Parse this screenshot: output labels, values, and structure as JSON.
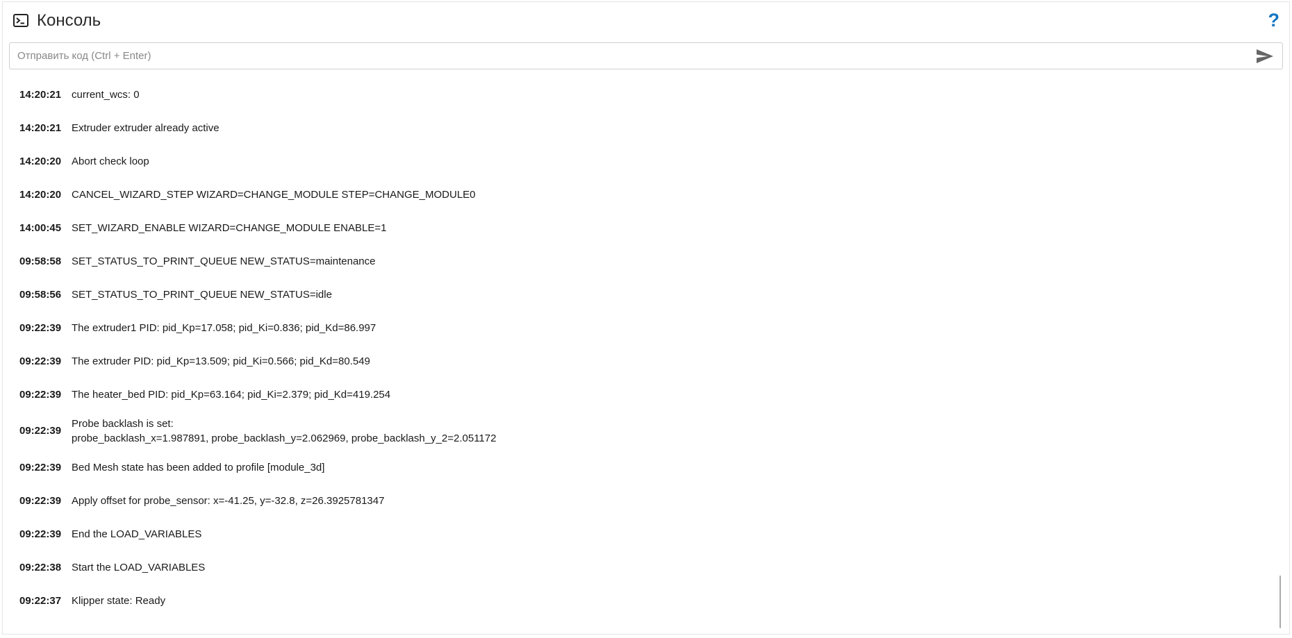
{
  "header": {
    "title": "Консоль",
    "help_label": "?"
  },
  "command_input": {
    "placeholder": "Отправить код (Ctrl + Enter)",
    "value": ""
  },
  "log": [
    {
      "time": "14:20:21",
      "message": "current_wcs: 0"
    },
    {
      "time": "14:20:21",
      "message": "Extruder extruder already active"
    },
    {
      "time": "14:20:20",
      "message": "Abort check loop"
    },
    {
      "time": "14:20:20",
      "message": "CANCEL_WIZARD_STEP WIZARD=CHANGE_MODULE STEP=CHANGE_MODULE0"
    },
    {
      "time": "14:00:45",
      "message": "SET_WIZARD_ENABLE WIZARD=CHANGE_MODULE ENABLE=1"
    },
    {
      "time": "09:58:58",
      "message": "SET_STATUS_TO_PRINT_QUEUE NEW_STATUS=maintenance"
    },
    {
      "time": "09:58:56",
      "message": "SET_STATUS_TO_PRINT_QUEUE NEW_STATUS=idle"
    },
    {
      "time": "09:22:39",
      "message": "The extruder1 PID: pid_Kp=17.058; pid_Ki=0.836; pid_Kd=86.997"
    },
    {
      "time": "09:22:39",
      "message": "The extruder PID: pid_Kp=13.509; pid_Ki=0.566; pid_Kd=80.549"
    },
    {
      "time": "09:22:39",
      "message": "The heater_bed PID: pid_Kp=63.164; pid_Ki=2.379; pid_Kd=419.254"
    },
    {
      "time": "09:22:39",
      "message": "Probe backlash is set:\nprobe_backlash_x=1.987891, probe_backlash_y=2.062969, probe_backlash_y_2=2.051172"
    },
    {
      "time": "09:22:39",
      "message": "Bed Mesh state has been added to profile [module_3d]"
    },
    {
      "time": "09:22:39",
      "message": "Apply offset for probe_sensor: x=-41.25, y=-32.8, z=26.3925781347"
    },
    {
      "time": "09:22:39",
      "message": "End the LOAD_VARIABLES"
    },
    {
      "time": "09:22:38",
      "message": "Start the LOAD_VARIABLES"
    },
    {
      "time": "09:22:37",
      "message": "Klipper state: Ready"
    }
  ],
  "colors": {
    "accent": "#1676c2",
    "border": "#e4e4e4"
  },
  "icons": {
    "title_icon": "terminal-icon",
    "send_icon": "send-icon",
    "help_icon": "help-icon"
  }
}
